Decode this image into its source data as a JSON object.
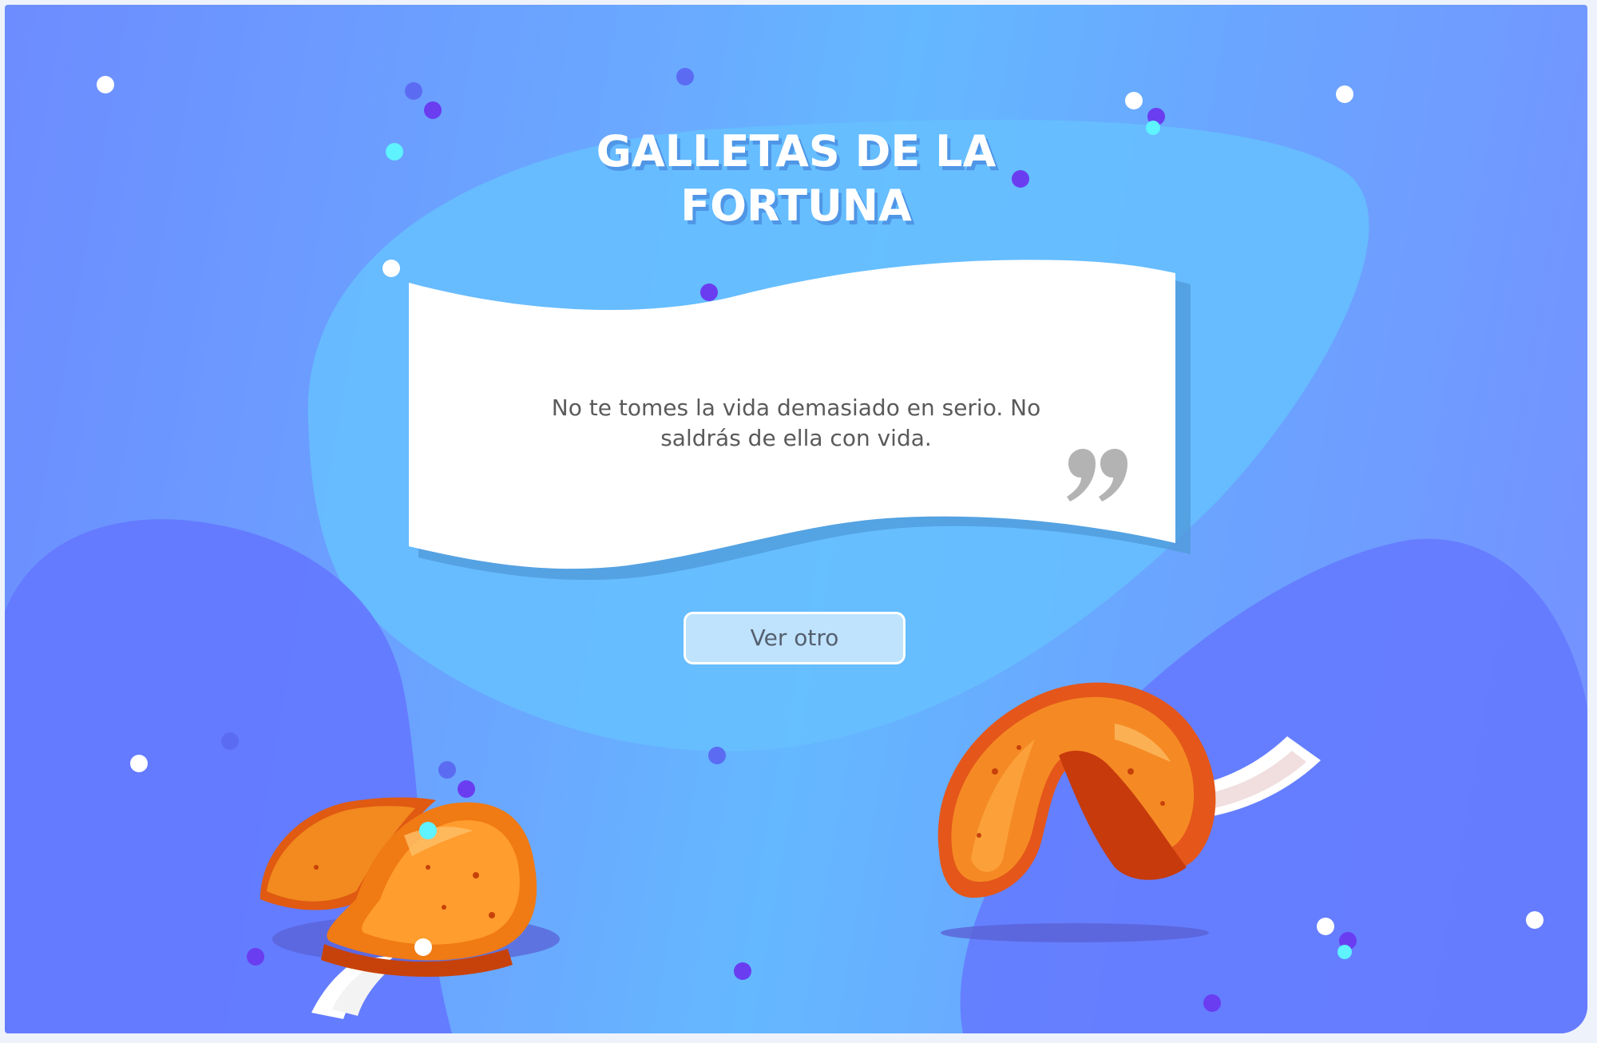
{
  "app": {
    "title": "GALLETAS DE LA FORTUNA"
  },
  "fortune": {
    "message": "No te tomes la vida demasiado en serio. No saldrás de ella con vida."
  },
  "actions": {
    "more_label": "Ver otro"
  },
  "icons": {
    "quote": "closing-quote-icon",
    "cookie_left": "fortune-cookie-icon",
    "cookie_right": "fortune-cookie-icon"
  },
  "colors": {
    "background_start": "#6d8cff",
    "background_center": "#64b8ff",
    "title_shadow": "#4f96e6",
    "note_paper": "#ffffff",
    "note_shadow": "#4f9ad8",
    "button_fill": "#bfe3fd",
    "cookie_orange": "#f28a1f",
    "confetti_purple": "#6a3df0",
    "confetti_cyan": "#5ff2ff"
  }
}
